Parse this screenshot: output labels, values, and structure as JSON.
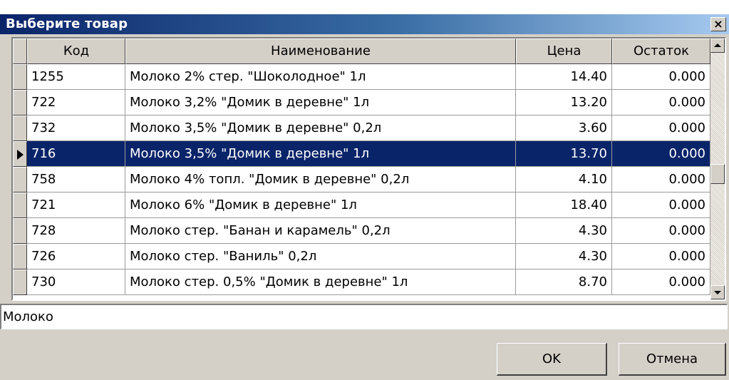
{
  "window": {
    "title": "Выберите товар"
  },
  "table": {
    "columns": [
      {
        "key": "code",
        "label": "Код"
      },
      {
        "key": "name",
        "label": "Наименование"
      },
      {
        "key": "price",
        "label": "Цена"
      },
      {
        "key": "stock",
        "label": "Остаток"
      }
    ],
    "rows": [
      {
        "code": "1255",
        "name": "Молоко 2% стер. \"Шоколодное\" 1л",
        "price": "14.40",
        "stock": "0.000",
        "selected": false
      },
      {
        "code": "722",
        "name": "Молоко 3,2% \"Домик в деревне\" 1л",
        "price": "13.20",
        "stock": "0.000",
        "selected": false
      },
      {
        "code": "732",
        "name": "Молоко 3,5% \"Домик в деревне\" 0,2л",
        "price": "3.60",
        "stock": "0.000",
        "selected": false
      },
      {
        "code": "716",
        "name": "Молоко 3,5% \"Домик в деревне\" 1л",
        "price": "13.70",
        "stock": "0.000",
        "selected": true
      },
      {
        "code": "758",
        "name": "Молоко 4% топл. \"Домик в деревне\" 0,2л",
        "price": "4.10",
        "stock": "0.000",
        "selected": false
      },
      {
        "code": "721",
        "name": "Молоко 6% \"Домик в деревне\" 1л",
        "price": "18.40",
        "stock": "0.000",
        "selected": false
      },
      {
        "code": "728",
        "name": "Молоко стер. \"Банан и карамель\" 0,2л",
        "price": "4.30",
        "stock": "0.000",
        "selected": false
      },
      {
        "code": "726",
        "name": "Молоко стер. \"Ваниль\" 0,2л",
        "price": "4.30",
        "stock": "0.000",
        "selected": false
      },
      {
        "code": "730",
        "name": "Молоко стер. 0,5% \"Домик в деревне\" 1л",
        "price": "8.70",
        "stock": "0.000",
        "selected": false
      }
    ]
  },
  "filter": {
    "value": "Молоко"
  },
  "buttons": {
    "ok": "OK",
    "cancel": "Отмена"
  },
  "colors": {
    "selection": "#0a246a",
    "face": "#d4d0c8"
  }
}
